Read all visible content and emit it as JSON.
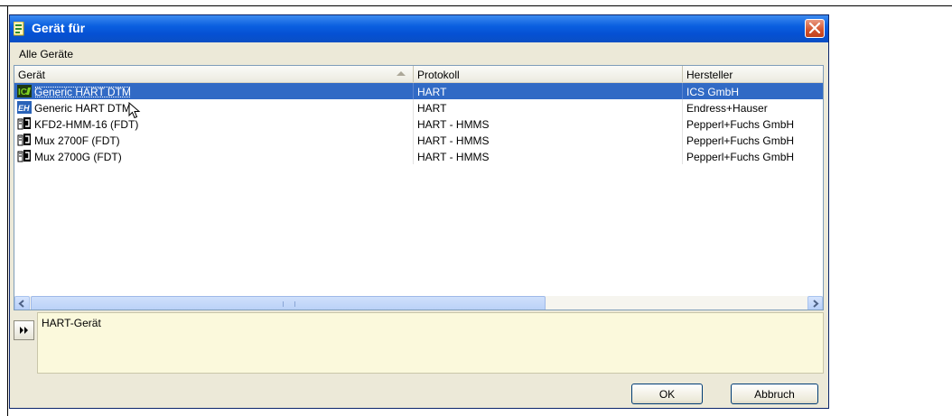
{
  "window": {
    "title": "Gerät für",
    "filter_label": "Alle Geräte"
  },
  "list": {
    "columns": [
      "Gerät",
      "Protokoll",
      "Hersteller"
    ],
    "rows": [
      {
        "device": "Generic HART DTM",
        "protocol": "HART",
        "manufacturer": "ICS GmbH",
        "icon": "ics-logo-icon",
        "selected": true
      },
      {
        "device": "Generic HART DTM",
        "protocol": "HART",
        "manufacturer": "Endress+Hauser",
        "icon": "endress-hauser-logo-icon",
        "selected": false
      },
      {
        "device": "KFD2-HMM-16 (FDT)",
        "protocol": "HART - HMMS",
        "manufacturer": "Pepperl+Fuchs GmbH",
        "icon": "pepperl-fuchs-logo-icon",
        "selected": false
      },
      {
        "device": "Mux 2700F (FDT)",
        "protocol": "HART - HMMS",
        "manufacturer": "Pepperl+Fuchs GmbH",
        "icon": "pepperl-fuchs-logo-icon",
        "selected": false
      },
      {
        "device": "Mux 2700G (FDT)",
        "protocol": "HART - HMMS",
        "manufacturer": "Pepperl+Fuchs GmbH",
        "icon": "pepperl-fuchs-logo-icon",
        "selected": false
      }
    ]
  },
  "description": {
    "text": "HART-Gerät"
  },
  "buttons": {
    "ok": "OK",
    "cancel": "Abbruch"
  },
  "colors": {
    "selection": "#316ac5",
    "titlebar": "#0a5fe0",
    "description_bg": "#fbf9dc"
  }
}
